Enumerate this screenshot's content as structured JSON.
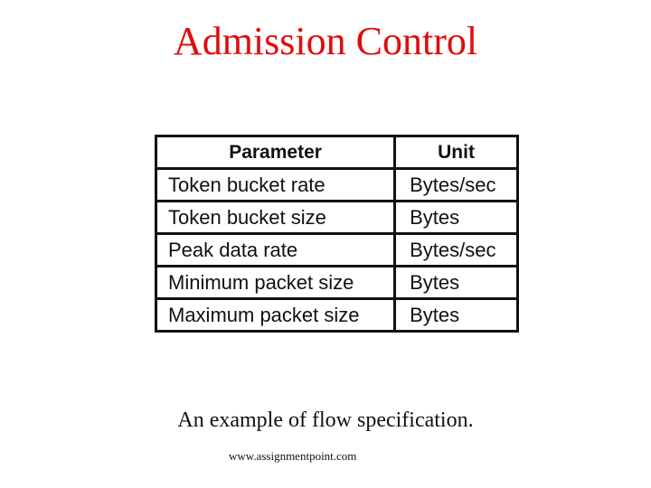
{
  "title": "Admission Control",
  "table": {
    "headers": [
      "Parameter",
      "Unit"
    ],
    "rows": [
      {
        "parameter": "Token bucket rate",
        "unit": "Bytes/sec"
      },
      {
        "parameter": "Token bucket size",
        "unit": "Bytes"
      },
      {
        "parameter": "Peak data rate",
        "unit": "Bytes/sec"
      },
      {
        "parameter": "Minimum packet size",
        "unit": "Bytes"
      },
      {
        "parameter": "Maximum packet size",
        "unit": "Bytes"
      }
    ]
  },
  "caption": "An example of flow specification.",
  "source": "www.assignmentpoint.com",
  "colors": {
    "title": "#e00d0d",
    "text": "#111111"
  }
}
